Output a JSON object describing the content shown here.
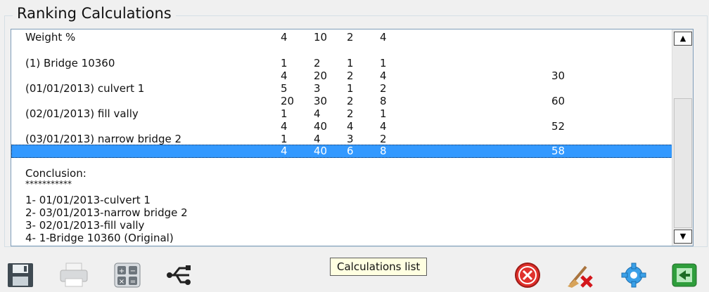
{
  "group_title": "Ranking Calculations",
  "rows": [
    {
      "label": "Weight %",
      "c1": "4",
      "c2": "10",
      "c3": "2",
      "c4": "4",
      "c5": ""
    },
    {
      "label": "(1) Bridge 10360",
      "c1": "1",
      "c2": "2",
      "c3": "1",
      "c4": "1",
      "c5": ""
    },
    {
      "label": "",
      "c1": "4",
      "c2": "20",
      "c3": "2",
      "c4": "4",
      "c5": "30"
    },
    {
      "label": "(01/01/2013) culvert 1",
      "c1": "5",
      "c2": "3",
      "c3": "1",
      "c4": "2",
      "c5": ""
    },
    {
      "label": "",
      "c1": "20",
      "c2": "30",
      "c3": "2",
      "c4": "8",
      "c5": "60"
    },
    {
      "label": "(02/01/2013) fill vally",
      "c1": "1",
      "c2": "4",
      "c3": "2",
      "c4": "1",
      "c5": ""
    },
    {
      "label": "",
      "c1": "4",
      "c2": "40",
      "c3": "4",
      "c4": "4",
      "c5": "52"
    },
    {
      "label": "(03/01/2013) narrow bridge 2",
      "c1": "1",
      "c2": "4",
      "c3": "3",
      "c4": "2",
      "c5": ""
    },
    {
      "label": "",
      "c1": "4",
      "c2": "40",
      "c3": "6",
      "c4": "8",
      "c5": "58"
    }
  ],
  "conclusion": {
    "heading": "Conclusion:",
    "stars": "***********",
    "items": [
      "1- 01/01/2013-culvert 1",
      "2- 03/01/2013-narrow bridge 2",
      "3- 02/01/2013-fill vally",
      "4- 1-Bridge 10360 (Original)"
    ]
  },
  "scrollbar": {
    "up": "▲",
    "down": "▼"
  },
  "tooltip": "Calculations list",
  "toolbar_icons": [
    "save-icon",
    "print-icon",
    "calculator-icon",
    "usb-icon",
    "close-icon",
    "clear-icon",
    "settings-icon",
    "exit-icon"
  ]
}
